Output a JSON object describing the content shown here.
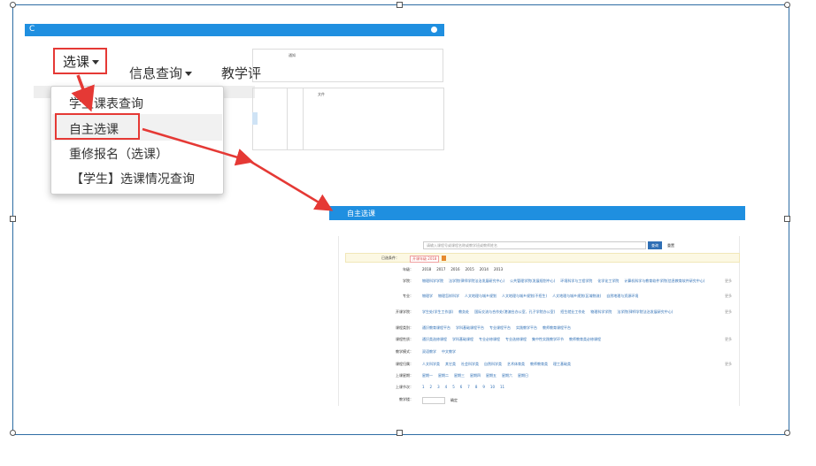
{
  "shot1": {
    "topbar_letter": "C",
    "nav": {
      "xuanke": "选课",
      "info_query": "信息查询",
      "jiaoxue": "教学评"
    },
    "panel_labels": {
      "a": "通知",
      "b": "",
      "c": "文件"
    },
    "dropdown_items": [
      "学生课表查询",
      "自主选课",
      "重修报名（选课）",
      "【学生】选课情况查询"
    ]
  },
  "shot2": {
    "title": "自主选课",
    "search_placeholder": "请输入课程号或课程名称或教学班或教师姓名",
    "search_label": "查询",
    "reset_label": "重置",
    "selected_label": "已选条件：",
    "selected_chip": "开课年级 2018",
    "rows": [
      {
        "label": "年级：",
        "values": [
          "2018",
          "2017",
          "2016",
          "2015",
          "2014",
          "2013"
        ],
        "more": ""
      },
      {
        "label": "学院：",
        "values": [
          "物理科学学院",
          "法学院(律师学院法治发展研究中心)",
          "公共管理学院(发展规划中心)",
          "环境科学与工程学院",
          "化学化工学院",
          "计算机科学与教育软件学院(信息教育软件研究中心)"
        ],
        "more": "更多"
      },
      {
        "label": "专业：",
        "values": [
          "物理学",
          "物理怎样科学",
          "人文地理与城乡规划",
          "人文地理与城乡规划(不招生)",
          "人文地理与城乡规划(区域物流)",
          "自然地理与资源环境"
        ],
        "more": "更多"
      },
      {
        "label": "开课学院：",
        "values": [
          "学生处(学生工作部)",
          "教务处",
          "国际交流与合作处(港澳台办公室、孔子学院办公室)",
          "招生就业工作处",
          "物理科学学院",
          "法学院(律师学院法治发展研究中心)"
        ],
        "more": "更多"
      },
      {
        "label": "课程类别：",
        "values": [
          "通识教育课程平台",
          "学科基础课程平台",
          "专业课程平台",
          "实践教学平台",
          "教师教育课程平台"
        ],
        "more": ""
      },
      {
        "label": "课程性质：",
        "values": [
          "通识类选修课程",
          "学科基础课程",
          "专业必修课程",
          "专业选修课程",
          "集中性实践教学环节",
          "教师教育类必修课程"
        ],
        "more": "更多"
      },
      {
        "label": "教学模式：",
        "values": [
          "双语教学",
          "中文教学"
        ],
        "more": ""
      },
      {
        "label": "课程归属：",
        "values": [
          "人文科学类",
          "其它类",
          "社会科学类",
          "自然科学类",
          "艺术体育类",
          "教师教育类",
          "理工基础类"
        ],
        "more": "更多"
      },
      {
        "label": "上课星期：",
        "values": [
          "星期一",
          "星期二",
          "星期三",
          "星期四",
          "星期五",
          "星期六",
          "星期日"
        ],
        "more": ""
      },
      {
        "label": "上课节次：",
        "values": [
          "1",
          "2",
          "3",
          "4",
          "5",
          "6",
          "7",
          "8",
          "9",
          "10",
          "11"
        ],
        "more": ""
      }
    ],
    "room_label": "教学楼：",
    "room_confirm": "确定"
  },
  "colors": {
    "brand_blue": "#1f8fe0",
    "highlight_red": "#e53935",
    "link_blue": "#2f6fb5"
  }
}
